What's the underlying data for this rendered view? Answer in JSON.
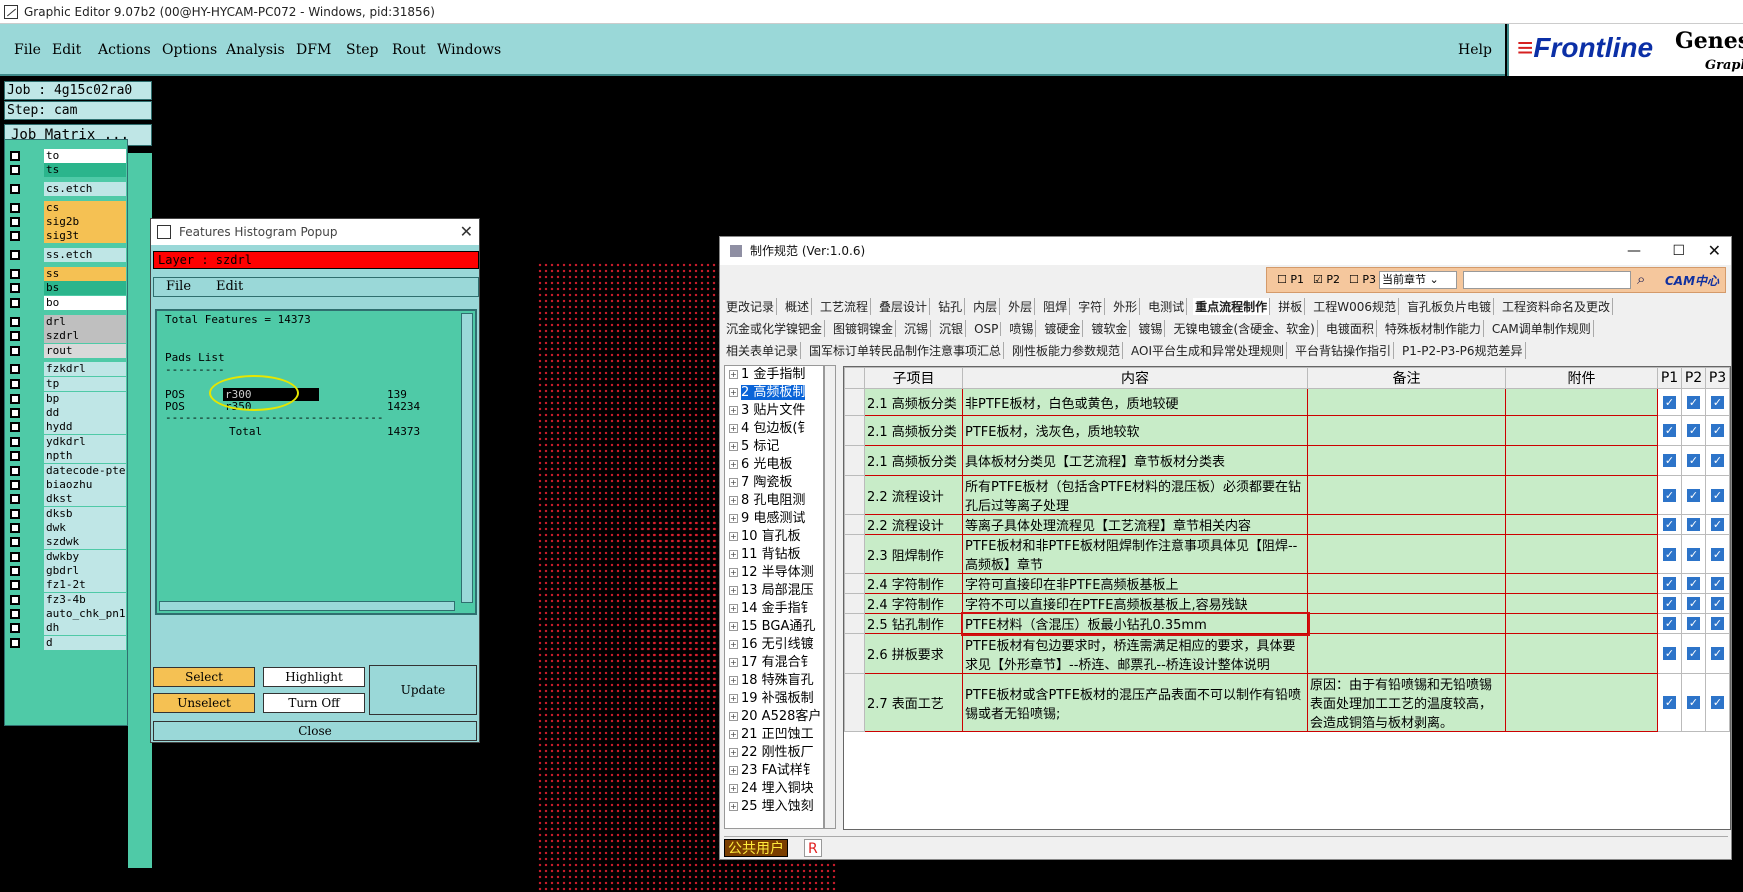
{
  "window_title": "Graphic Editor 9.07b2 (00@HY-HYCAM-PC072 - Windows, pid:31856)",
  "menu": {
    "items": [
      "File",
      "Edit",
      "Actions",
      "Options",
      "Analysis",
      "DFM",
      "Step",
      "Rout",
      "Windows"
    ],
    "help": "Help"
  },
  "logo": {
    "brand": "Frontline",
    "product": "Genesis",
    "sub": "Graphic"
  },
  "job": {
    "job_label": "Job : 4g15c02ra0",
    "step_label": "Step: cam",
    "matrix_button": "Job Matrix ..."
  },
  "layers": [
    {
      "name": "to",
      "color": "#ffffff"
    },
    {
      "name": "ts",
      "color": "#2bb58c"
    },
    {
      "name": "cs.etch",
      "color": "#bfe6e6"
    },
    {
      "name": "cs",
      "color": "#f5c153"
    },
    {
      "name": "sig2b",
      "color": "#f5c153"
    },
    {
      "name": "sig3t",
      "color": "#f5c153"
    },
    {
      "name": "ss.etch",
      "color": "#bfe6e6"
    },
    {
      "name": "ss",
      "color": "#f5c153"
    },
    {
      "name": "bs",
      "color": "#2bb58c"
    },
    {
      "name": "bo",
      "color": "#ffffff"
    },
    {
      "name": "drl",
      "color": "#bfbfbf"
    },
    {
      "name": "szdrl",
      "color": "#bfbfbf"
    },
    {
      "name": "rout",
      "color": "#d9d9d9"
    },
    {
      "name": "fzkdrl",
      "color": "#bfe6e6"
    },
    {
      "name": "tp",
      "color": "#bfe6e6"
    },
    {
      "name": "bp",
      "color": "#bfe6e6"
    },
    {
      "name": "dd",
      "color": "#bfe6e6"
    },
    {
      "name": "hydd",
      "color": "#bfe6e6"
    },
    {
      "name": "ydkdrl",
      "color": "#bfe6e6"
    },
    {
      "name": "npth",
      "color": "#bfe6e6"
    },
    {
      "name": "datecode-pte",
      "color": "#bfe6e6"
    },
    {
      "name": "biaozhu",
      "color": "#bfe6e6"
    },
    {
      "name": "dkst",
      "color": "#bfe6e6"
    },
    {
      "name": "dksb",
      "color": "#bfe6e6"
    },
    {
      "name": "dwk",
      "color": "#bfe6e6"
    },
    {
      "name": "szdwk",
      "color": "#bfe6e6"
    },
    {
      "name": "dwkby",
      "color": "#bfe6e6"
    },
    {
      "name": "gbdrl",
      "color": "#bfe6e6"
    },
    {
      "name": "fz1-2t",
      "color": "#bfe6e6"
    },
    {
      "name": "fz3-4b",
      "color": "#bfe6e6"
    },
    {
      "name": "auto_chk_pn1",
      "color": "#bfe6e6"
    },
    {
      "name": "dh",
      "color": "#bfe6e6"
    },
    {
      "name": "d",
      "color": "#bfe6e6"
    }
  ],
  "histogram": {
    "title": "Features Histogram Popup",
    "layer_label": "Layer :  szdrl",
    "menu_file": "File",
    "menu_edit": "Edit",
    "total_features": "Total Features = 14373",
    "pads_list": "Pads List",
    "underline": "---------",
    "rows": [
      {
        "type": "POS",
        "sym": "r300",
        "count": "139"
      },
      {
        "type": "POS",
        "sym": "r350",
        "count": "14234"
      }
    ],
    "dashes": "---------------------------------",
    "total_label": "Total",
    "total_value": "14373",
    "select": "Select",
    "highlight": "Highlight",
    "unselect": "Unselect",
    "turn_off": "Turn Off",
    "update": "Update",
    "close": "Close"
  },
  "spec": {
    "title": "制作规范 (Ver:1.0.6)",
    "filter": {
      "p1": "P1",
      "p2": "P2",
      "p3": "P3",
      "scope": "当前章节"
    },
    "cam_logo": "CAM中心",
    "tabs_row1": [
      "更改记录",
      "概述",
      "工艺流程",
      "叠层设计",
      "钻孔",
      "内层",
      "外层",
      "阻焊",
      "字符",
      "外形",
      "电测试",
      "重点流程制作",
      "拼板",
      "工程W006规范",
      "盲孔板负片电镀",
      "工程资料命名及更改"
    ],
    "tabs_row2": [
      "沉金或化学镍钯金",
      "图镀铜镍金",
      "沉锡",
      "沉银",
      "OSP",
      "喷锡",
      "镀硬金",
      "镀软金",
      "镀锡",
      "无镍电镀金(含硬金、软金)",
      "电镀面积",
      "特殊板材制作能力",
      "CAM调单制作规则"
    ],
    "tabs_row3": [
      "相关表单记录",
      "国军标订单转民品制作注意事项汇总",
      "刚性板能力参数规范",
      "AOI平台生成和异常处理规则",
      "平台背钻操作指引",
      "P1-P2-P3-P6规范差异"
    ],
    "tree": [
      "1 金手指制",
      "2 高频板制",
      "3 贴片文件",
      "4 包边板(钅",
      "5 标记",
      "6 光电板",
      "7 陶瓷板",
      "8 孔电阻测",
      "9 电感测试",
      "10 盲孔板",
      "11 背钻板",
      "12 半导体测",
      "13 局部混压",
      "14 金手指钅",
      "15 BGA通孔",
      "16 无引线镀",
      "17 有混合钅",
      "18 特殊盲孔",
      "19 补强板制",
      "20 A528客户",
      "21 正凹蚀工",
      "22 刚性板厂",
      "23 FA试样钅",
      "24 埋入铜块",
      "25 埋入蚀刻"
    ],
    "headers": [
      "子项目",
      "内容",
      "备注",
      "附件",
      "P1",
      "P2",
      "P3"
    ],
    "rows": [
      {
        "item": "2.1 高频板分类",
        "content": "非PTFE板材，白色或黄色，质地较硬",
        "note": ""
      },
      {
        "item": "2.1 高频板分类",
        "content": "PTFE板材，浅灰色，质地较软",
        "note": ""
      },
      {
        "item": "2.1 高频板分类",
        "content": "具体板材分类见【工艺流程】章节板材分类表",
        "note": ""
      },
      {
        "item": "2.2 流程设计",
        "content": "所有PTFE板材（包括含PTFE材料的混压板）必须都要在钻孔后过等离子处理",
        "note": ""
      },
      {
        "item": "2.2 流程设计",
        "content": "等离子具体处理流程见【工艺流程】章节相关内容",
        "note": ""
      },
      {
        "item": "2.3 阻焊制作",
        "content": "PTFE板材和非PTFE板材阻焊制作注意事项具体见【阻焊--高频板】章节",
        "note": ""
      },
      {
        "item": "2.4 字符制作",
        "content": "字符可直接印在非PTFE高频板基板上",
        "note": ""
      },
      {
        "item": "2.4 字符制作",
        "content": "字符不可以直接印在PTFE高频板基板上,容易残缺",
        "note": ""
      },
      {
        "item": "2.5 钻孔制作",
        "content": "PTFE材料（含混压）板最小钻孔0.35mm",
        "note": ""
      },
      {
        "item": "2.6 拼板要求",
        "content": "PTFE板材有包边要求时，桥连需满足相应的要求，具体要求见【外形章节】--桥连、邮票孔--桥连设计整体说明",
        "note": ""
      },
      {
        "item": "2.7 表面工艺",
        "content": "PTFE板材或含PTFE板材的混压产品表面不可以制作有铅喷锡或者无铅喷锡;",
        "note": "原因：由于有铅喷锡和无铅喷锡表面处理加工工艺的温度较高，会造成铜箔与板材剥离。"
      }
    ],
    "status_user": "公共用户",
    "status_r": "R"
  }
}
